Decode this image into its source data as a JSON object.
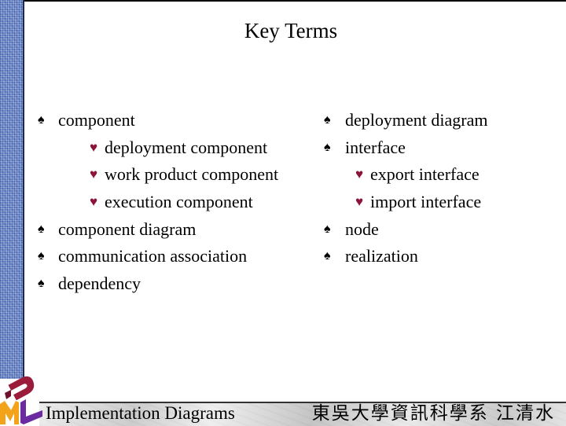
{
  "slide": {
    "title": "Key Terms",
    "left_column": [
      {
        "level": 1,
        "bullet": "♠",
        "icon": "spade-bullet-icon",
        "text": "component"
      },
      {
        "level": 2,
        "bullet": "♥",
        "icon": "heart-bullet-icon",
        "text": "deployment component"
      },
      {
        "level": 2,
        "bullet": "♥",
        "icon": "heart-bullet-icon",
        "text": "work product component"
      },
      {
        "level": 2,
        "bullet": "♥",
        "icon": "heart-bullet-icon",
        "text": "execution component"
      },
      {
        "level": 1,
        "bullet": "♠",
        "icon": "spade-bullet-icon",
        "text": "component diagram"
      },
      {
        "level": 1,
        "bullet": "♠",
        "icon": "spade-bullet-icon",
        "text": "communication association"
      },
      {
        "level": 1,
        "bullet": "♠",
        "icon": "spade-bullet-icon",
        "text": "dependency"
      }
    ],
    "right_column": [
      {
        "level": 1,
        "bullet": "♠",
        "icon": "spade-bullet-icon",
        "text": "deployment diagram"
      },
      {
        "level": 1,
        "bullet": "♠",
        "icon": "spade-bullet-icon",
        "text": "interface"
      },
      {
        "level": 2,
        "bullet": "♥",
        "icon": "heart-bullet-icon",
        "text": "export interface"
      },
      {
        "level": 2,
        "bullet": "♥",
        "icon": "heart-bullet-icon",
        "text": "import interface"
      },
      {
        "level": 1,
        "bullet": "♠",
        "icon": "spade-bullet-icon",
        "text": "node"
      },
      {
        "level": 1,
        "bullet": "♠",
        "icon": "spade-bullet-icon",
        "text": "realization"
      }
    ]
  },
  "footer": {
    "logo": "uml-logo",
    "left_text": "Implementation Diagrams",
    "right_text": "東吳大學資訊科學系 江清水"
  },
  "colors": {
    "heart_bullet": "#8b1538",
    "side_strip": "#6a86c6",
    "logo_red": "#9b1b3b",
    "logo_orange": "#f3a31a",
    "logo_purple": "#6b2aa0"
  }
}
